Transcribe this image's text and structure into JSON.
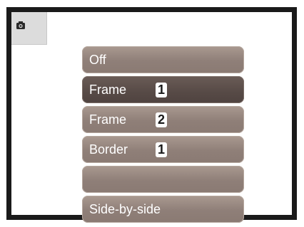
{
  "mode_icon": "camera-icon",
  "menu": {
    "items": [
      {
        "label": "Off",
        "badge": ""
      },
      {
        "label": "Frame",
        "badge": "1"
      },
      {
        "label": "Frame",
        "badge": "2"
      },
      {
        "label": "Border",
        "badge": "1"
      },
      {
        "label": "",
        "badge": ""
      },
      {
        "label": "Side-by-side",
        "badge": ""
      }
    ],
    "selected_index": 1
  },
  "colors": {
    "item_bg": "#8f7f78",
    "item_selected_bg": "#574a46",
    "frame": "#1a1a1a"
  }
}
